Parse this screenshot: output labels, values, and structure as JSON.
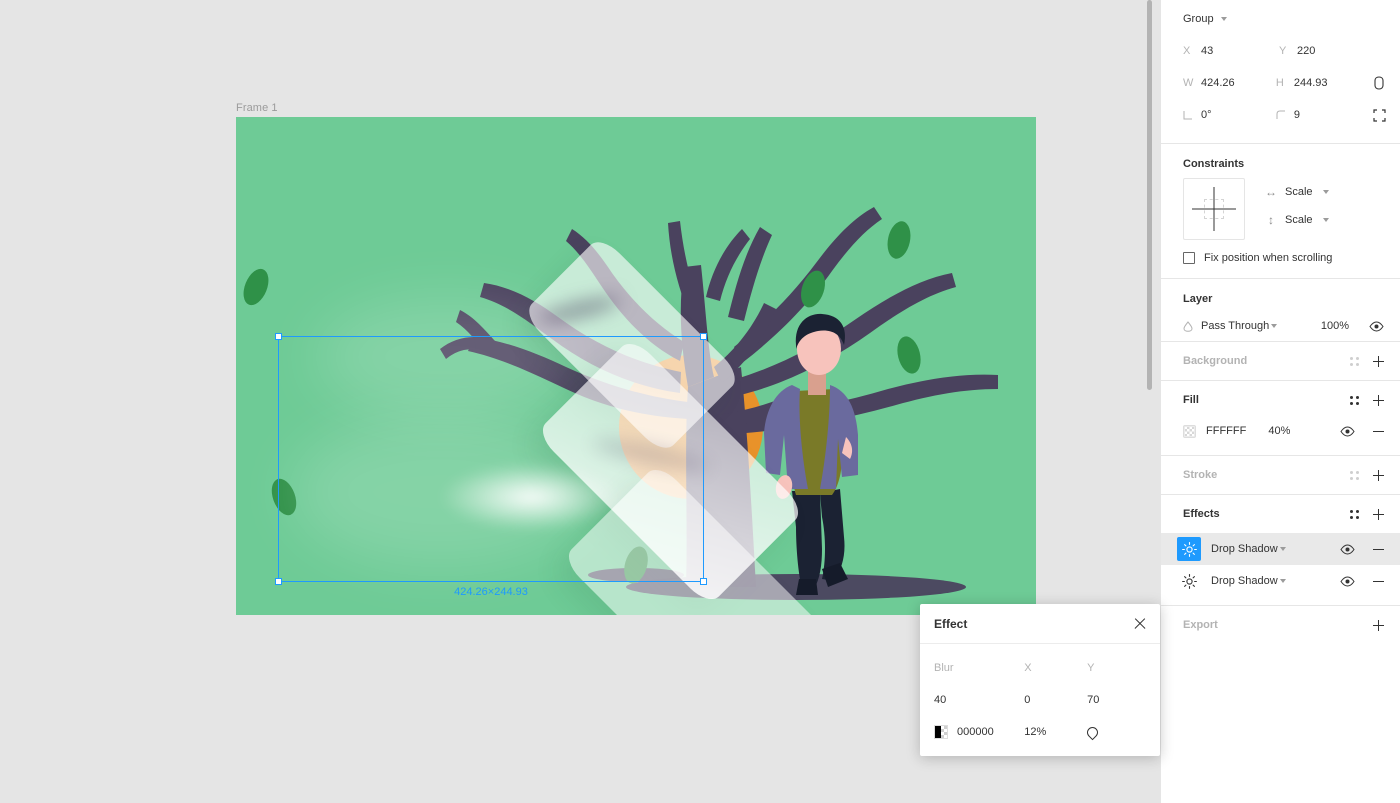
{
  "canvas": {
    "frame_label": "Frame 1",
    "selection_size": "424.26×244.93",
    "frame_bg": "#6ECB96",
    "selection_color": "#1e9afe"
  },
  "inspector": {
    "object": {
      "name": "Group"
    },
    "transform": {
      "x_label": "X",
      "x_value": "43",
      "y_label": "Y",
      "y_value": "220",
      "w_label": "W",
      "w_value": "424.26",
      "h_label": "H",
      "h_value": "244.93",
      "rotation_value": "0°",
      "corner_radius_value": "9"
    },
    "constraints": {
      "title": "Constraints",
      "horizontal": "Scale",
      "vertical": "Scale",
      "fix_position_label": "Fix position when scrolling"
    },
    "layer": {
      "title": "Layer",
      "blend_mode": "Pass Through",
      "opacity": "100%"
    },
    "background": {
      "title": "Background"
    },
    "fill": {
      "title": "Fill",
      "color": "FFFFFF",
      "opacity": "40%"
    },
    "stroke": {
      "title": "Stroke"
    },
    "effects": {
      "title": "Effects",
      "items": [
        {
          "name": "Drop Shadow",
          "selected": true
        },
        {
          "name": "Drop Shadow",
          "selected": false
        }
      ]
    },
    "export": {
      "title": "Export"
    }
  },
  "effect_popup": {
    "title": "Effect",
    "blur_label": "Blur",
    "x_label": "X",
    "y_label": "Y",
    "blur_value": "40",
    "x_value": "0",
    "y_value": "70",
    "color": "000000",
    "color_opacity": "12%"
  }
}
